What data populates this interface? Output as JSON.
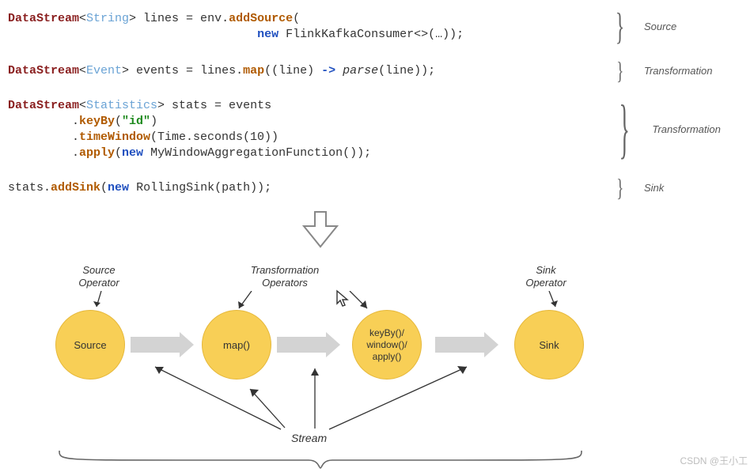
{
  "code": {
    "line1a": "DataStream",
    "line1b": "String",
    "line1c": "> lines = env.",
    "line1d": "addSource",
    "line1e": "(",
    "line1f": "                                   ",
    "line1g": "new",
    "line1h": " FlinkKafkaConsumer<>(…));",
    "line2a": "DataStream",
    "line2b": "Event",
    "line2c": "> events = lines.",
    "line2d": "map",
    "line2e": "((line) ",
    "line2f": "->",
    "line2g": " ",
    "line2h": "parse",
    "line2i": "(line));",
    "line3a": "DataStream",
    "line3b": "Statistics",
    "line3c": "> stats = events",
    "line3d": "         .",
    "line3e": "keyBy",
    "line3f": "(",
    "line3g": "\"id\"",
    "line3h": ")",
    "line3i": "         .",
    "line3j": "timeWindow",
    "line3k": "(Time.seconds(10))",
    "line3l": "         .",
    "line3m": "apply",
    "line3n": "(",
    "line3o": "new",
    "line3p": " MyWindowAggregationFunction());",
    "line4a": "stats.",
    "line4b": "addSink",
    "line4c": "(",
    "line4d": "new",
    "line4e": " RollingSink(path));"
  },
  "sections": {
    "s1": "Source",
    "s2": "Transformation",
    "s3": "Transformation",
    "s4": "Sink"
  },
  "diagram": {
    "nodes": {
      "source": "Source",
      "map": "map()",
      "keyby": "keyBy()/\nwindow()/\napply()",
      "sink": "Sink"
    },
    "labels": {
      "source_op": "Source\nOperator",
      "transform_ops": "Transformation\nOperators",
      "sink_op": "Sink\nOperator",
      "stream": "Stream"
    }
  },
  "watermark": "CSDN @王小工"
}
